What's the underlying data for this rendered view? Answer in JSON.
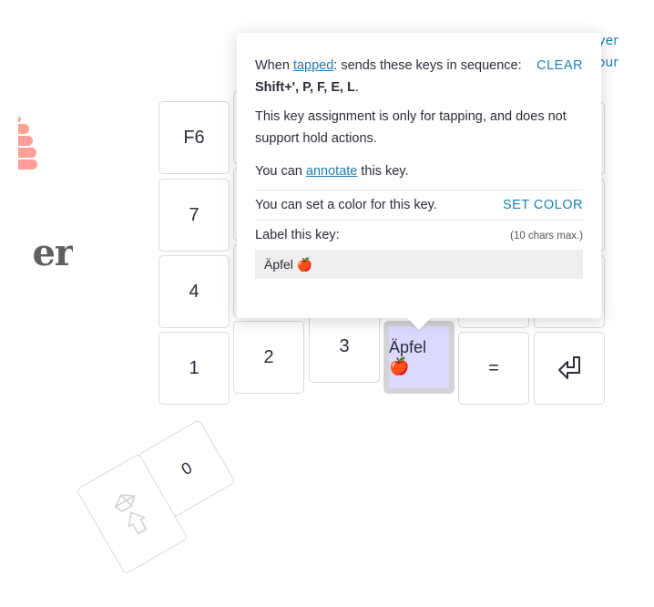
{
  "background": {
    "logo_text_fragment": "er",
    "side_links": [
      "yer",
      "our"
    ]
  },
  "keys": {
    "row1": [
      "F6"
    ],
    "row2": [
      "7"
    ],
    "row3": [
      "4"
    ],
    "row4": [
      "1",
      "2",
      "3",
      "Äpfel 🍎",
      "=",
      "⏎"
    ],
    "thumb": [
      "0",
      ""
    ]
  },
  "selected_key_color": "#dcd9ff",
  "popover": {
    "tap_prefix": "When ",
    "tap_link": "tapped",
    "tap_suffix": ": sends these keys in sequence:",
    "clear_label": "CLEAR",
    "sequence": "Shift+', P, F, E, L",
    "sequence_end": ".",
    "hold_note": "This key assignment is only for tapping, and does not support hold actions.",
    "annotate_prefix": "You can ",
    "annotate_link": "annotate",
    "annotate_suffix": " this key.",
    "color_text": "You can set a color for this key.",
    "set_color_label": "SET COLOR",
    "label_title": "Label this key:",
    "label_limit": "(10 chars max.)",
    "label_value": "Äpfel 🍎"
  }
}
